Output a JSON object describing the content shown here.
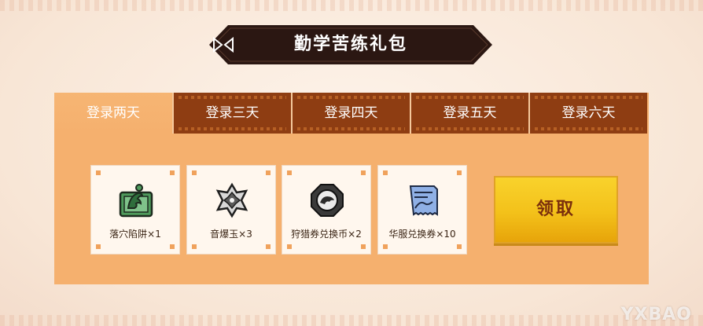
{
  "banner": {
    "title": "勤学苦练礼包"
  },
  "tabs": [
    {
      "label": "登录两天",
      "active": true
    },
    {
      "label": "登录三天",
      "active": false
    },
    {
      "label": "登录四天",
      "active": false
    },
    {
      "label": "登录五天",
      "active": false
    },
    {
      "label": "登录六天",
      "active": false
    }
  ],
  "rewards": [
    {
      "label": "落穴陷阱×1",
      "icon": "pitfall-trap-icon"
    },
    {
      "label": "音爆玉×3",
      "icon": "sonic-bomb-icon"
    },
    {
      "label": "狩猎券兑换币×2",
      "icon": "hunt-voucher-coin-icon"
    },
    {
      "label": "华服兑换券×10",
      "icon": "outfit-voucher-icon"
    }
  ],
  "claim": {
    "label": "领取"
  },
  "watermark": {
    "text": "YXBAO"
  },
  "colors": {
    "tab_inactive": "#8e3d12",
    "panel": "#f5b06e",
    "button": "#f9d22c",
    "button_text": "#7a2e0c"
  }
}
